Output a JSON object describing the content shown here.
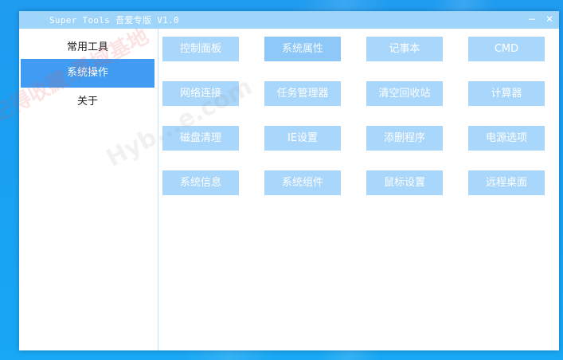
{
  "window": {
    "title": "Super Tools 吾爱专版 V1.0",
    "minimize_glyph": "−",
    "close_glyph": "✕"
  },
  "sidebar": {
    "items": [
      {
        "label": "常用工具",
        "active": false
      },
      {
        "label": "系统操作",
        "active": true
      },
      {
        "label": "关于",
        "active": false
      }
    ]
  },
  "tools": [
    {
      "label": "控制面板"
    },
    {
      "label": "系统属性"
    },
    {
      "label": "记事本"
    },
    {
      "label": "CMD"
    },
    {
      "label": "网络连接"
    },
    {
      "label": "任务管理器"
    },
    {
      "label": "清空回收站"
    },
    {
      "label": "计算器"
    },
    {
      "label": "磁盘清理"
    },
    {
      "label": "IE设置"
    },
    {
      "label": "添删程序"
    },
    {
      "label": "电源选项"
    },
    {
      "label": "系统信息"
    },
    {
      "label": "系统组件"
    },
    {
      "label": "鼠标设置"
    },
    {
      "label": "远程桌面"
    }
  ],
  "watermark": {
    "text_cn": "记得收藏:黑域基地",
    "text_en": "Hyb...e.com"
  },
  "colors": {
    "desktop": "#1aa0f2",
    "titlebar": "#9fd4fb",
    "sidebar_active": "#3f9cf2",
    "tool_button": "#a9d6fb",
    "tool_button_hover": "#8ec8f8"
  }
}
